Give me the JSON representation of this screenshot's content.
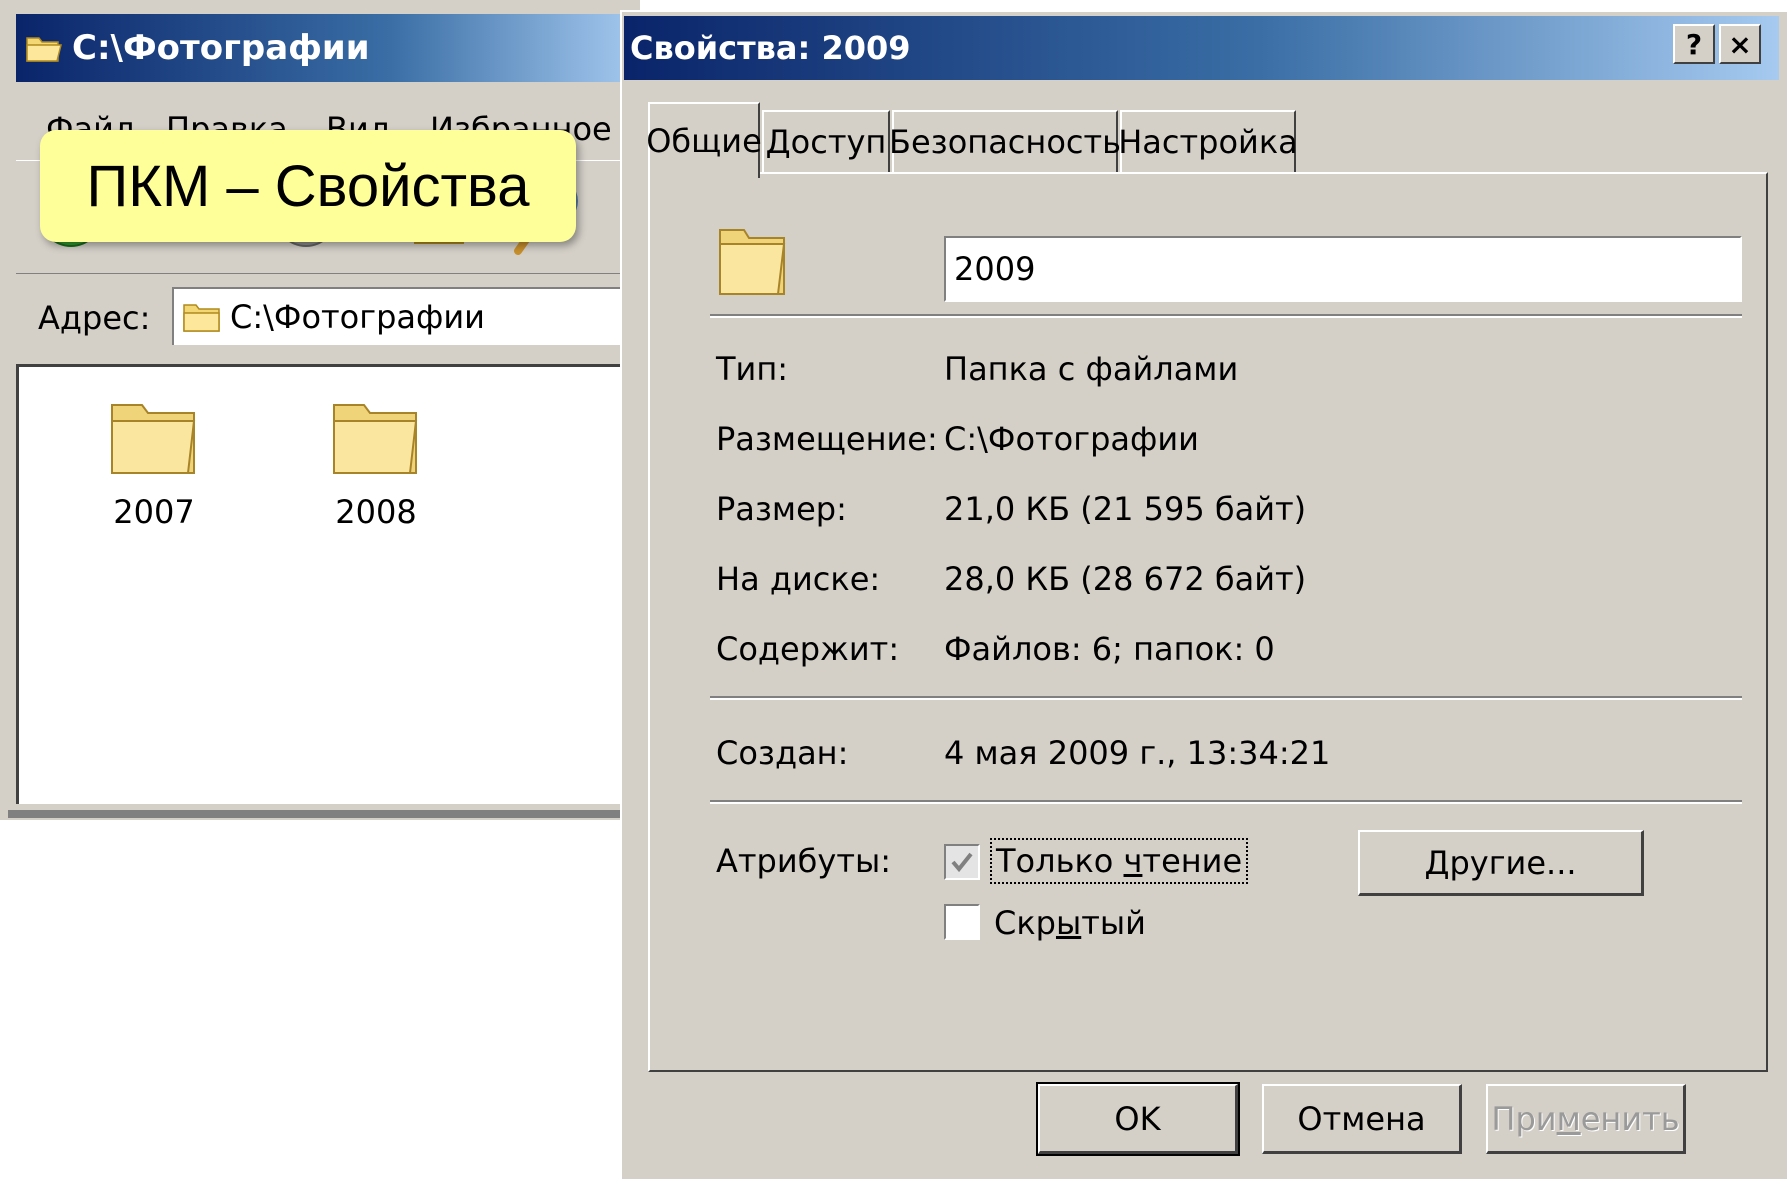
{
  "explorer": {
    "title": "C:\\Фотографии",
    "menu": [
      "Файл",
      "Правка",
      "Вид",
      "Избранное"
    ],
    "address_label": "Адрес:",
    "address_value": "C:\\Фотографии",
    "folders": [
      "2007",
      "2008"
    ]
  },
  "callout": {
    "text": "ПКМ – Свойства"
  },
  "dialog": {
    "title": "Свойства: 2009",
    "help_button": "?",
    "close_button": "×",
    "tabs": [
      "Общие",
      "Доступ",
      "Безопасность",
      "Настройка"
    ],
    "active_tab": "Общие",
    "folder_name": "2009",
    "props": {
      "type_label": "Тип:",
      "type_value": "Папка с файлами",
      "location_label": "Размещение:",
      "location_value": "C:\\Фотографии",
      "size_label": "Размер:",
      "size_value": "21,0 КБ (21 595 байт)",
      "disk_label": "На диске:",
      "disk_value": "28,0 КБ (28 672 байт)",
      "contains_label": "Содержит:",
      "contains_value": "Файлов: 6; папок: 0",
      "created_label": "Создан:",
      "created_value": "4 мая 2009 г., 13:34:21"
    },
    "attributes": {
      "label": "Атрибуты:",
      "readonly_pre": "Только ",
      "readonly_ul": "ч",
      "readonly_post": "тение",
      "readonly_checked": true,
      "hidden_pre": "Скр",
      "hidden_ul": "ы",
      "hidden_post": "тый",
      "hidden_checked": false,
      "other_pre": "",
      "other_ul": "Д",
      "other_post": "ругие..."
    },
    "buttons": {
      "ok": "OK",
      "cancel": "Отмена",
      "apply_pre": "При",
      "apply_ul": "м",
      "apply_post": "енить"
    }
  }
}
